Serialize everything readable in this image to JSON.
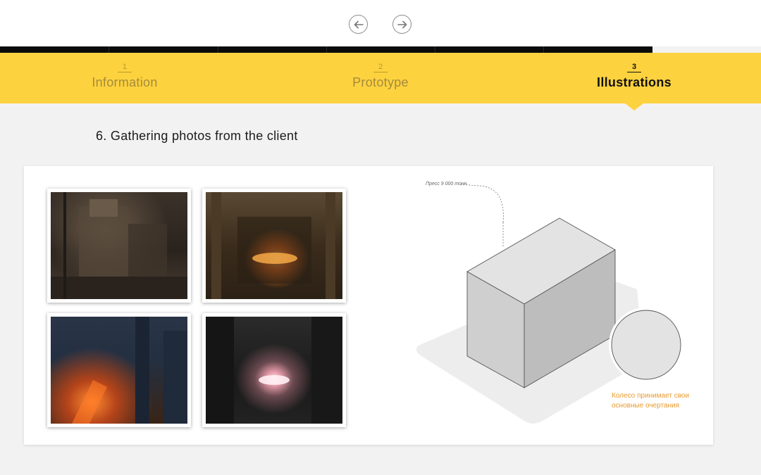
{
  "navigation": {
    "prev_icon": "arrow-left-icon",
    "next_icon": "arrow-right-icon"
  },
  "steps": [
    {
      "number": "1",
      "label": "Information",
      "active": false
    },
    {
      "number": "2",
      "label": "Prototype",
      "active": false
    },
    {
      "number": "3",
      "label": "Illustrations",
      "active": true
    }
  ],
  "section": {
    "title": "6. Gathering photos from the client"
  },
  "illustration": {
    "callout_top": "Пресс 9 000 тонн",
    "callout_bottom": "Колесо принимает свои основные очертания"
  },
  "colors": {
    "accent": "#fdd23f",
    "callout": "#e89a2e"
  }
}
